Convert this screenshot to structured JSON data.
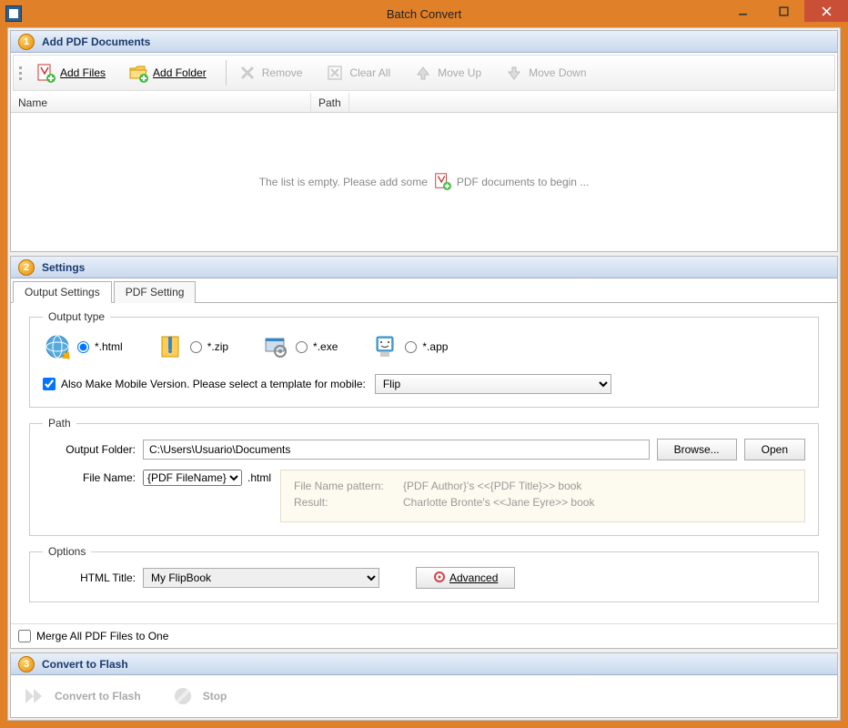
{
  "window": {
    "title": "Batch Convert"
  },
  "sections": {
    "s1": {
      "title": "Add PDF Documents",
      "badge": "1"
    },
    "s2": {
      "title": "Settings",
      "badge": "2"
    },
    "s3": {
      "title": "Convert to Flash",
      "badge": "3"
    }
  },
  "toolbar1": {
    "add_files": "Add Files",
    "add_folder": "Add Folder",
    "remove": "Remove",
    "clear_all": "Clear All",
    "move_up": "Move Up",
    "move_down": "Move Down"
  },
  "list": {
    "col_name": "Name",
    "col_path": "Path",
    "empty_pre": "The list is empty. Please add some",
    "empty_post": "PDF documents to begin ..."
  },
  "tabs": {
    "output": "Output Settings",
    "pdf": "PDF Setting"
  },
  "output_type": {
    "legend": "Output type",
    "html": "*.html",
    "zip": "*.zip",
    "exe": "*.exe",
    "app": "*.app",
    "mobile_label": "Also Make Mobile Version. Please select a template for mobile:",
    "mobile_value": "Flip"
  },
  "path": {
    "legend": "Path",
    "output_folder_label": "Output Folder:",
    "output_folder_value": "C:\\Users\\Usuario\\Documents",
    "browse": "Browse...",
    "open": "Open",
    "file_name_label": "File Name:",
    "file_name_value": "{PDF FileName}",
    "file_ext": ".html",
    "hint_pattern_k": "File Name pattern:",
    "hint_pattern_v": "{PDF Author}'s <<{PDF Title}>> book",
    "hint_result_k": "Result:",
    "hint_result_v": "Charlotte Bronte's <<Jane Eyre>> book"
  },
  "options": {
    "legend": "Options",
    "html_title_label": "HTML Title:",
    "html_title_value": "My FlipBook",
    "advanced": "Advanced"
  },
  "merge_label": "Merge All PDF Files to One",
  "convert": {
    "convert": "Convert to Flash",
    "stop": "Stop"
  }
}
